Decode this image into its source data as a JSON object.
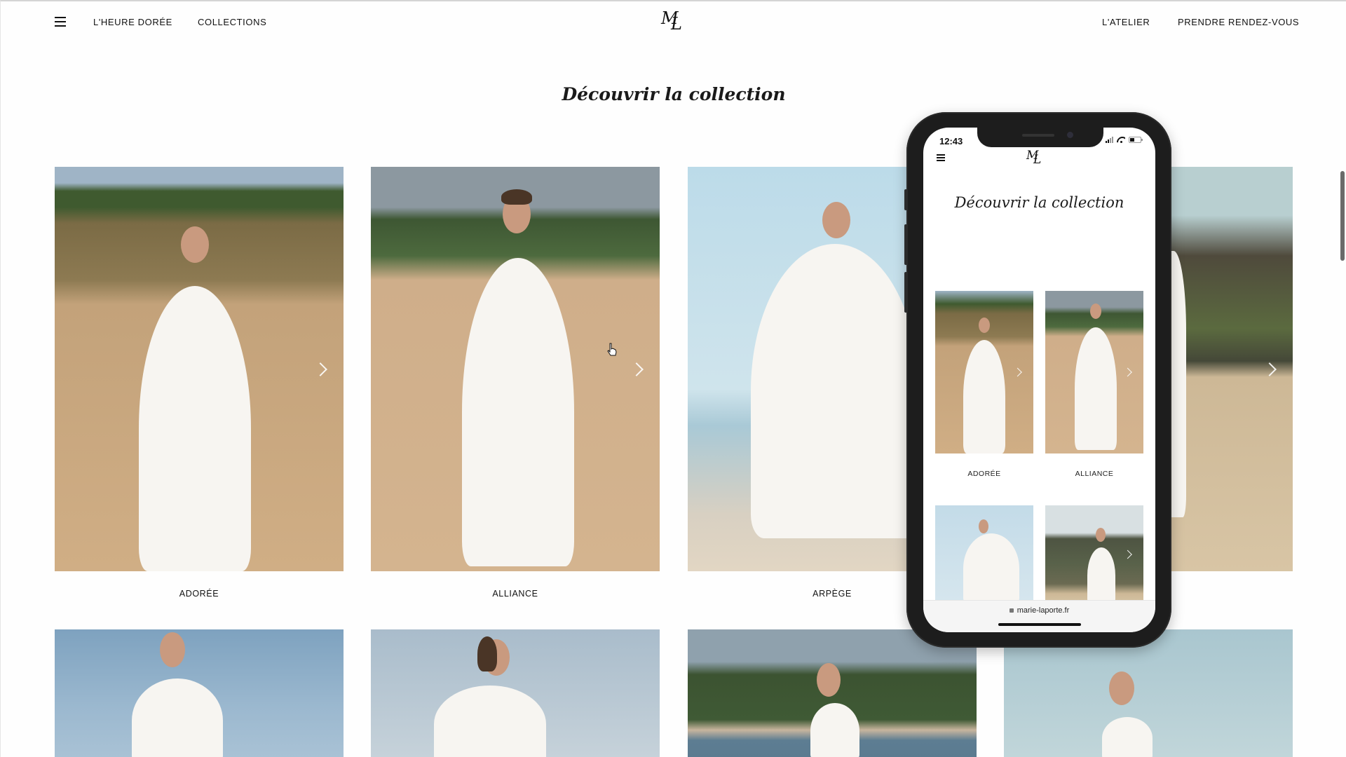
{
  "nav": {
    "menu_icon": "hamburger-icon",
    "left_links": [
      "L'HEURE DORÉE",
      "COLLECTIONS"
    ],
    "logo": {
      "m": "M",
      "l": "L"
    },
    "right_links": [
      "L'ATELIER",
      "PRENDRE RENDEZ-VOUS"
    ]
  },
  "main": {
    "title": "Découvrir la collection",
    "cards": [
      {
        "label": "ADORÉE",
        "scene": "beach-cliff"
      },
      {
        "label": "ALLIANCE",
        "scene": "beach-sand"
      },
      {
        "label": "ARPÈGE",
        "scene": "sea-sky"
      },
      {
        "label": "",
        "scene": "rocks"
      },
      {
        "label": "",
        "scene": "sky-clouds"
      },
      {
        "label": "",
        "scene": "sky-pale"
      },
      {
        "label": "",
        "scene": "lake-trees"
      },
      {
        "label": "",
        "scene": "sky-teal"
      }
    ],
    "next_icon": "chevron-right-icon"
  },
  "phone": {
    "status_time": "12:43",
    "title": "Découvrir la collection",
    "logo": {
      "m": "M",
      "l": "L"
    },
    "cards": [
      {
        "label": "ADORÉE",
        "scene": "beach-cliff"
      },
      {
        "label": "ALLIANCE",
        "scene": "beach-sand"
      },
      {
        "label": "",
        "scene": "sea-sky"
      },
      {
        "label": "",
        "scene": "rocks"
      }
    ],
    "url": "marie-laporte.fr"
  },
  "colors": {
    "text": "#111111",
    "background": "#fefefe",
    "phone_frame": "#1d1d1d"
  }
}
